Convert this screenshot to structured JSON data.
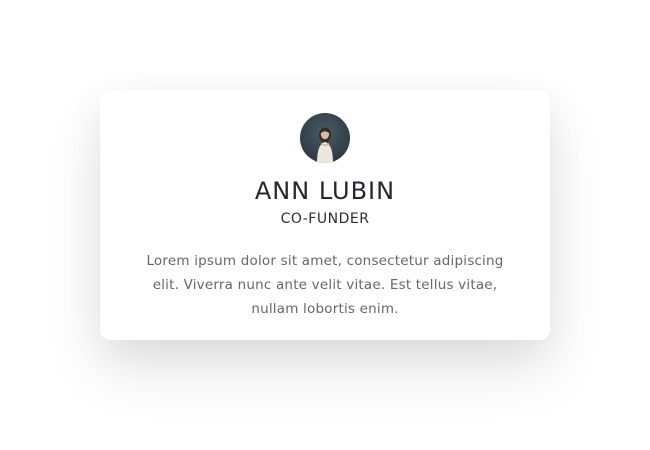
{
  "profile": {
    "name": "ANN LUBIN",
    "role": "CO-FUNDER",
    "bio": "Lorem ipsum dolor sit amet, consectetur adipiscing elit. Viverra nunc ante velit vitae. Est tellus vitae, nullam lobortis enim.",
    "avatar_icon": "person-photo"
  }
}
